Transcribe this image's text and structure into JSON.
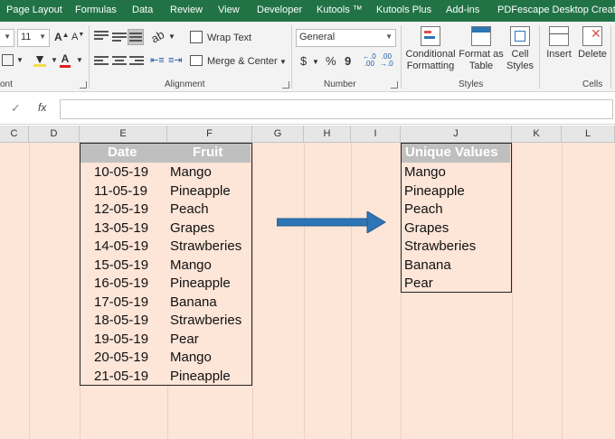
{
  "ribbon_tabs": [
    "Page Layout",
    "Formulas",
    "Data",
    "Review",
    "View",
    "Developer",
    "Kutools ™",
    "Kutools Plus",
    "Add-ins",
    "PDFescape Desktop Creator"
  ],
  "ribbon": {
    "font_size": "11",
    "wrap_text": "Wrap Text",
    "merge_center": "Merge & Center",
    "number_format": "General",
    "currency": "$",
    "percent": "%",
    "comma": "9",
    "conditional_formatting": [
      "Conditional",
      "Formatting"
    ],
    "format_as_table": [
      "Format as",
      "Table"
    ],
    "cell_styles": [
      "Cell",
      "Styles"
    ],
    "insert": "Insert",
    "delete": "Delete",
    "groups": {
      "font": "ont",
      "alignment": "Alignment",
      "number": "Number",
      "styles": "Styles",
      "cells": "Cells"
    }
  },
  "formula_bar": {
    "cancel": "✓",
    "fx": "fx"
  },
  "columns": [
    "C",
    "D",
    "E",
    "F",
    "G",
    "H",
    "I",
    "J",
    "K",
    "L"
  ],
  "source_table": {
    "headers": {
      "date": "Date",
      "fruit": "Fruit"
    },
    "rows": [
      {
        "date": "10-05-19",
        "fruit": "Mango"
      },
      {
        "date": "11-05-19",
        "fruit": "Pineapple"
      },
      {
        "date": "12-05-19",
        "fruit": "Peach"
      },
      {
        "date": "13-05-19",
        "fruit": "Grapes"
      },
      {
        "date": "14-05-19",
        "fruit": "Strawberies"
      },
      {
        "date": "15-05-19",
        "fruit": "Mango"
      },
      {
        "date": "16-05-19",
        "fruit": "Pineapple"
      },
      {
        "date": "17-05-19",
        "fruit": "Banana"
      },
      {
        "date": "18-05-19",
        "fruit": "Strawberies"
      },
      {
        "date": "19-05-19",
        "fruit": "Pear"
      },
      {
        "date": "20-05-19",
        "fruit": "Mango"
      },
      {
        "date": "21-05-19",
        "fruit": "Pineapple"
      }
    ]
  },
  "unique_table": {
    "header": "Unique Values",
    "values": [
      "Mango",
      "Pineapple",
      "Peach",
      "Grapes",
      "Strawberies",
      "Banana",
      "Pear"
    ]
  },
  "colors": {
    "ribbon_green": "#217346",
    "sheet_fill": "#fde5d8",
    "header_gray": "#bfbfbf",
    "arrow_blue": "#2e75b6"
  }
}
